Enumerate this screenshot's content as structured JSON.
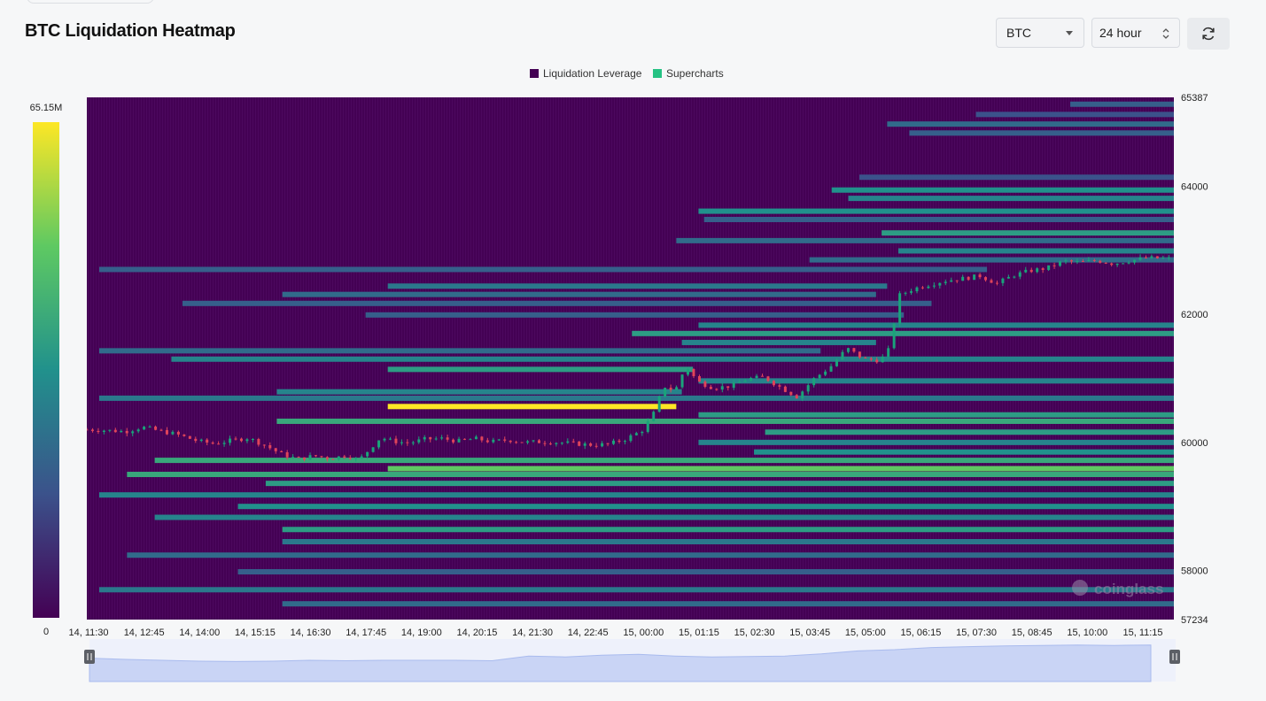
{
  "header": {
    "title": "BTC Liquidation Heatmap",
    "coin": "BTC",
    "range": "24 hour"
  },
  "colors": {
    "heat_low": "#440154",
    "heat_mid": "#21918c",
    "heat_high": "#fde725",
    "candle_up": "#1aa37a",
    "candle_down": "#e0445a"
  },
  "icons": {
    "refresh": "refresh-icon",
    "caret": "chevron-down-icon",
    "spinner": "up-down-icon"
  },
  "watermark": "coinglass",
  "chart_data": {
    "type": "heatmap",
    "title": "BTC Liquidation Heatmap",
    "legend": [
      {
        "name": "Liquidation Leverage",
        "color": "#440154"
      },
      {
        "name": "Supercharts",
        "color": "#25c283"
      }
    ],
    "legend_position": "top-center",
    "colorbar": {
      "max_label": "65.15M",
      "min_label": "0",
      "range": [
        0,
        65150000
      ]
    },
    "y_ticks": [
      65387,
      64000,
      62000,
      60000,
      58000,
      57234
    ],
    "ylim": [
      57234,
      65387
    ],
    "x_ticks": [
      "14, 11:30",
      "14, 12:45",
      "14, 14:00",
      "14, 15:15",
      "14, 16:30",
      "14, 17:45",
      "14, 19:00",
      "14, 20:15",
      "14, 21:30",
      "14, 22:45",
      "15, 00:00",
      "15, 01:15",
      "15, 02:30",
      "15, 03:45",
      "15, 05:00",
      "15, 06:15",
      "15, 07:30",
      "15, 08:45",
      "15, 10:00",
      "15, 11:15"
    ],
    "bands": [
      {
        "price": 65280,
        "start": 17.5,
        "end": 19.5,
        "v": 0.3
      },
      {
        "price": 65120,
        "start": 15.8,
        "end": 19.5,
        "v": 0.25
      },
      {
        "price": 64970,
        "start": 14.2,
        "end": 19.5,
        "v": 0.35
      },
      {
        "price": 64830,
        "start": 14.6,
        "end": 19.5,
        "v": 0.3
      },
      {
        "price": 64140,
        "start": 13.7,
        "end": 19.5,
        "v": 0.25
      },
      {
        "price": 63940,
        "start": 13.2,
        "end": 19.5,
        "v": 0.5
      },
      {
        "price": 63810,
        "start": 13.5,
        "end": 19.5,
        "v": 0.45
      },
      {
        "price": 63610,
        "start": 10.8,
        "end": 19.5,
        "v": 0.5
      },
      {
        "price": 63480,
        "start": 10.9,
        "end": 19.5,
        "v": 0.3
      },
      {
        "price": 63270,
        "start": 14.1,
        "end": 19.5,
        "v": 0.55
      },
      {
        "price": 63150,
        "start": 10.4,
        "end": 19.5,
        "v": 0.35
      },
      {
        "price": 62990,
        "start": 14.4,
        "end": 19.5,
        "v": 0.45
      },
      {
        "price": 62850,
        "start": 12.8,
        "end": 19.5,
        "v": 0.35
      },
      {
        "price": 62700,
        "start": 0.0,
        "end": 16.0,
        "v": 0.3
      },
      {
        "price": 62440,
        "start": 5.2,
        "end": 14.2,
        "v": 0.4
      },
      {
        "price": 62310,
        "start": 3.3,
        "end": 14.0,
        "v": 0.35
      },
      {
        "price": 62170,
        "start": 1.5,
        "end": 15.0,
        "v": 0.3
      },
      {
        "price": 61990,
        "start": 4.8,
        "end": 14.5,
        "v": 0.3
      },
      {
        "price": 61830,
        "start": 10.8,
        "end": 19.5,
        "v": 0.45
      },
      {
        "price": 61700,
        "start": 9.6,
        "end": 19.5,
        "v": 0.55
      },
      {
        "price": 61560,
        "start": 10.5,
        "end": 14.0,
        "v": 0.45
      },
      {
        "price": 61430,
        "start": 0.0,
        "end": 13.0,
        "v": 0.35
      },
      {
        "price": 61300,
        "start": 1.3,
        "end": 19.5,
        "v": 0.45
      },
      {
        "price": 61140,
        "start": 5.2,
        "end": 10.7,
        "v": 0.55
      },
      {
        "price": 60960,
        "start": 10.8,
        "end": 19.5,
        "v": 0.45
      },
      {
        "price": 60790,
        "start": 3.2,
        "end": 10.5,
        "v": 0.45
      },
      {
        "price": 60690,
        "start": 0.0,
        "end": 19.5,
        "v": 0.4
      },
      {
        "price": 60560,
        "start": 5.2,
        "end": 10.4,
        "v": 1.0
      },
      {
        "price": 60430,
        "start": 10.8,
        "end": 19.5,
        "v": 0.55
      },
      {
        "price": 60330,
        "start": 3.2,
        "end": 19.5,
        "v": 0.6
      },
      {
        "price": 60160,
        "start": 12.0,
        "end": 19.5,
        "v": 0.55
      },
      {
        "price": 60000,
        "start": 10.8,
        "end": 19.5,
        "v": 0.45
      },
      {
        "price": 59850,
        "start": 11.8,
        "end": 19.5,
        "v": 0.5
      },
      {
        "price": 59720,
        "start": 1.0,
        "end": 19.5,
        "v": 0.6
      },
      {
        "price": 59590,
        "start": 5.2,
        "end": 19.5,
        "v": 0.75
      },
      {
        "price": 59500,
        "start": 0.5,
        "end": 19.5,
        "v": 0.6
      },
      {
        "price": 59360,
        "start": 3.0,
        "end": 19.5,
        "v": 0.55
      },
      {
        "price": 59180,
        "start": 0.0,
        "end": 19.5,
        "v": 0.45
      },
      {
        "price": 59000,
        "start": 2.5,
        "end": 19.5,
        "v": 0.5
      },
      {
        "price": 58830,
        "start": 1.0,
        "end": 19.5,
        "v": 0.45
      },
      {
        "price": 58640,
        "start": 3.3,
        "end": 19.5,
        "v": 0.55
      },
      {
        "price": 58450,
        "start": 3.3,
        "end": 19.5,
        "v": 0.4
      },
      {
        "price": 58240,
        "start": 0.5,
        "end": 19.5,
        "v": 0.35
      },
      {
        "price": 57980,
        "start": 2.5,
        "end": 19.5,
        "v": 0.3
      },
      {
        "price": 57700,
        "start": 0.0,
        "end": 19.5,
        "v": 0.4
      },
      {
        "price": 57480,
        "start": 3.3,
        "end": 19.5,
        "v": 0.35
      }
    ],
    "price_path": [
      [
        0.0,
        60200
      ],
      [
        0.3,
        60190
      ],
      [
        0.7,
        60170
      ],
      [
        1.0,
        60240
      ],
      [
        1.3,
        60180
      ],
      [
        1.6,
        60130
      ],
      [
        2.0,
        60020
      ],
      [
        2.3,
        59980
      ],
      [
        2.6,
        60030
      ],
      [
        2.9,
        60070
      ],
      [
        3.2,
        59960
      ],
      [
        3.5,
        59820
      ],
      [
        3.8,
        59740
      ],
      [
        4.1,
        59790
      ],
      [
        4.4,
        59750
      ],
      [
        4.7,
        59800
      ],
      [
        4.9,
        59720
      ],
      [
        5.1,
        59900
      ],
      [
        5.3,
        60080
      ],
      [
        5.5,
        60020
      ],
      [
        5.8,
        59990
      ],
      [
        6.1,
        60050
      ],
      [
        6.4,
        60060
      ],
      [
        6.7,
        60020
      ],
      [
        7.0,
        60060
      ],
      [
        7.3,
        60010
      ],
      [
        7.6,
        60040
      ],
      [
        7.9,
        60000
      ],
      [
        8.2,
        60010
      ],
      [
        8.5,
        60000
      ],
      [
        8.8,
        59980
      ],
      [
        9.1,
        59960
      ],
      [
        9.4,
        59970
      ],
      [
        9.7,
        60050
      ],
      [
        10.0,
        60180
      ],
      [
        10.2,
        60420
      ],
      [
        10.4,
        60880
      ],
      [
        10.6,
        60800
      ],
      [
        10.8,
        61200
      ],
      [
        11.0,
        60950
      ],
      [
        11.3,
        60850
      ],
      [
        11.6,
        60880
      ],
      [
        11.9,
        60990
      ],
      [
        12.2,
        61020
      ],
      [
        12.5,
        60860
      ],
      [
        12.8,
        60710
      ],
      [
        13.1,
        60990
      ],
      [
        13.4,
        61180
      ],
      [
        13.7,
        61470
      ],
      [
        14.0,
        61300
      ],
      [
        14.3,
        61280
      ],
      [
        14.5,
        61500
      ],
      [
        14.6,
        62280
      ],
      [
        14.9,
        62400
      ],
      [
        15.2,
        62470
      ],
      [
        15.5,
        62530
      ],
      [
        15.8,
        62560
      ],
      [
        16.1,
        62600
      ],
      [
        16.4,
        62480
      ],
      [
        16.7,
        62610
      ],
      [
        17.0,
        62680
      ],
      [
        17.3,
        62720
      ],
      [
        17.6,
        62830
      ],
      [
        17.9,
        62810
      ],
      [
        18.2,
        62840
      ],
      [
        18.5,
        62790
      ],
      [
        18.8,
        62840
      ],
      [
        19.1,
        62880
      ],
      [
        19.5,
        62870
      ]
    ],
    "navigator": {
      "values": [
        0.55,
        0.52,
        0.5,
        0.48,
        0.47,
        0.48,
        0.5,
        0.49,
        0.5,
        0.5,
        0.5,
        0.49,
        0.6,
        0.58,
        0.62,
        0.64,
        0.6,
        0.58,
        0.59,
        0.6,
        0.65,
        0.72,
        0.75,
        0.8,
        0.82,
        0.84,
        0.85,
        0.86,
        0.85,
        0.86
      ]
    }
  }
}
